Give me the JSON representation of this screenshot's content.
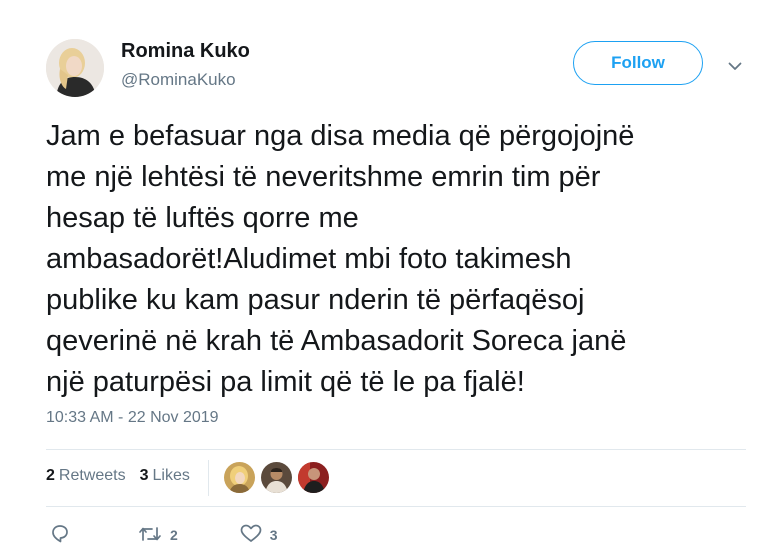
{
  "author": {
    "name": "Romina Kuko",
    "handle": "@RominaKuko",
    "avatar_icon": "profile-photo"
  },
  "follow_button": {
    "label": "Follow"
  },
  "menu": {
    "icon": "chevron-down-icon"
  },
  "tweet": {
    "text": "Jam e befasuar nga disa media që përgojojnë\nme një lehtësi të neveritshme emrin tim për\nhesap të luftës qorre me\nambasadorët!Aludimet mbi foto takimesh\npublike ku kam pasur nderin të përfaqësoj\nqeverinë në krah të Ambasadorit Soreca janë\nnjë paturpësi pa limit që të le pa fjalë!",
    "timestamp": "10:33 AM - 22 Nov 2019"
  },
  "stats": {
    "retweets_count": "2",
    "retweets_label": "Retweets",
    "likes_count": "3",
    "likes_label": "Likes"
  },
  "likers": [
    {
      "icon": "liker-avatar-1"
    },
    {
      "icon": "liker-avatar-2"
    },
    {
      "icon": "liker-avatar-3"
    }
  ],
  "actions": {
    "reply_icon": "reply-icon",
    "retweet_icon": "retweet-icon",
    "retweet_count": "2",
    "like_icon": "heart-icon",
    "like_count": "3"
  },
  "colors": {
    "accent": "#1da1f2",
    "secondary_text": "#657786",
    "divider": "#e1e8ed"
  }
}
